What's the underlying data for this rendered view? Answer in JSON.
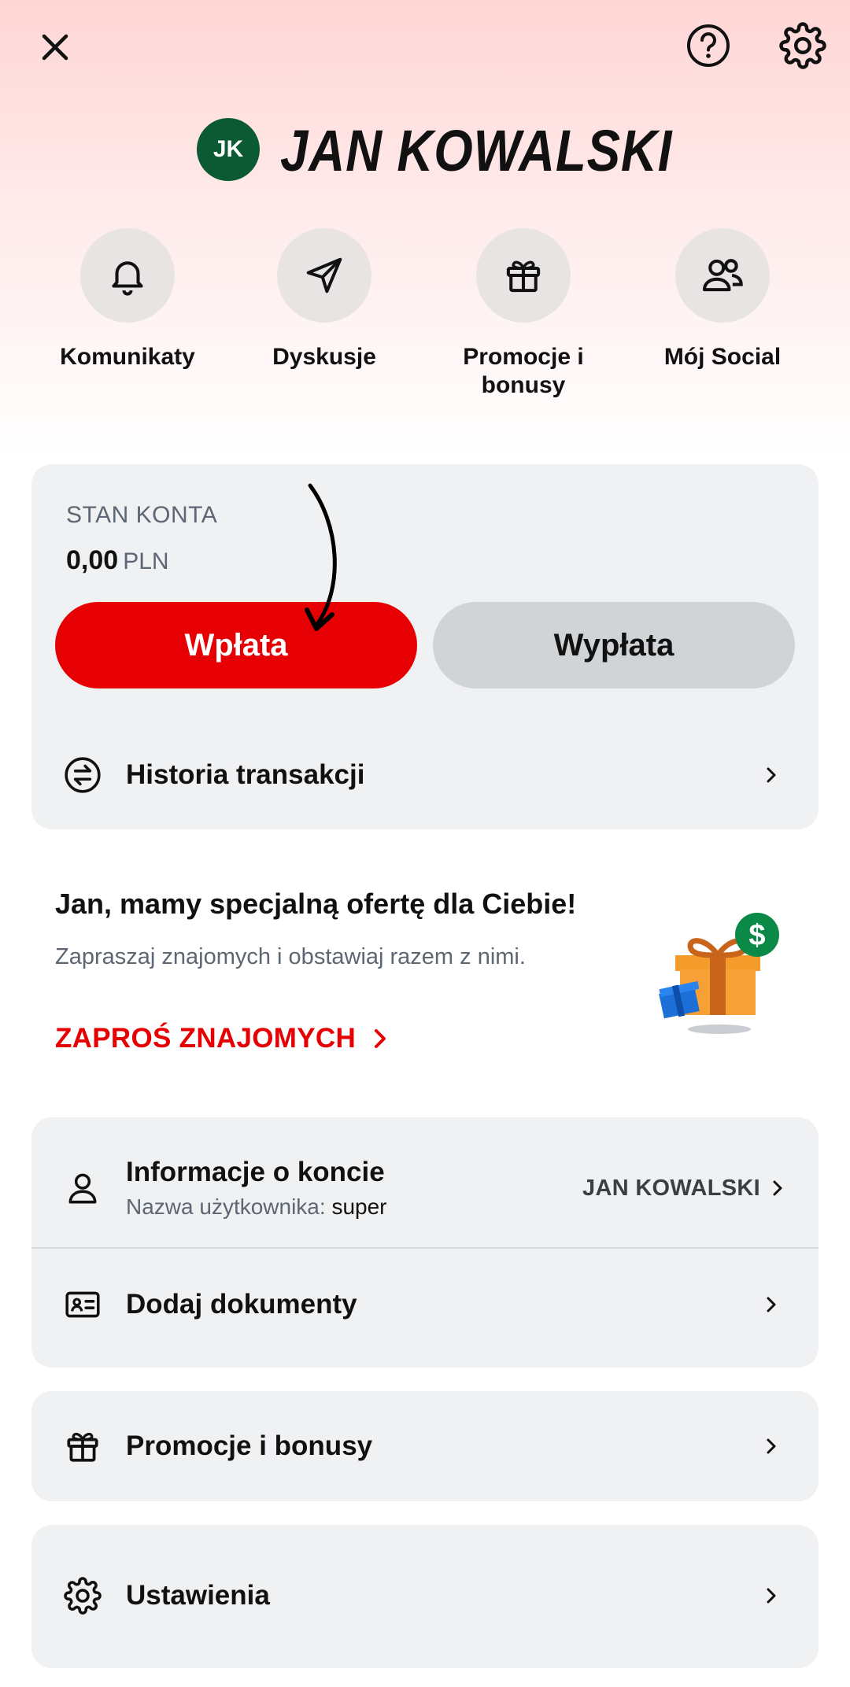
{
  "header": {
    "close_icon": "close-icon",
    "help_icon": "question-circle-icon",
    "settings_icon": "gear-icon"
  },
  "profile": {
    "initials": "JK",
    "name": "JAN KOWALSKI",
    "avatar_color": "#0b5a33"
  },
  "quick_actions": [
    {
      "label": "Komunikaty",
      "icon": "bell-icon"
    },
    {
      "label": "Dyskusje",
      "icon": "send-icon"
    },
    {
      "label": "Promocje i bonusy",
      "icon": "gift-icon"
    },
    {
      "label": "Mój Social",
      "icon": "users-icon"
    }
  ],
  "account": {
    "balance_label": "STAN KONTA",
    "balance_value": "0,00",
    "currency": "PLN",
    "deposit_label": "Wpłata",
    "withdraw_label": "Wypłata",
    "history_label": "Historia transakcji"
  },
  "promo": {
    "title": "Jan, mamy specjalną ofertę dla Ciebie!",
    "subtitle": "Zapraszaj znajomych i obstawiaj razem z nimi.",
    "cta": "ZAPROŚ ZNAJOMYCH"
  },
  "menu": {
    "account_info": {
      "label": "Informacje o koncie",
      "username_prefix": "Nazwa użytkownika:",
      "username": "super",
      "right_value": "JAN KOWALSKI"
    },
    "documents_label": "Dodaj dokumenty",
    "promotions_label": "Promocje i bonusy",
    "settings_label": "Ustawienia"
  },
  "colors": {
    "accent_red": "#e60003",
    "card_bg": "#f0f1f3",
    "muted_text": "#5d6673"
  }
}
